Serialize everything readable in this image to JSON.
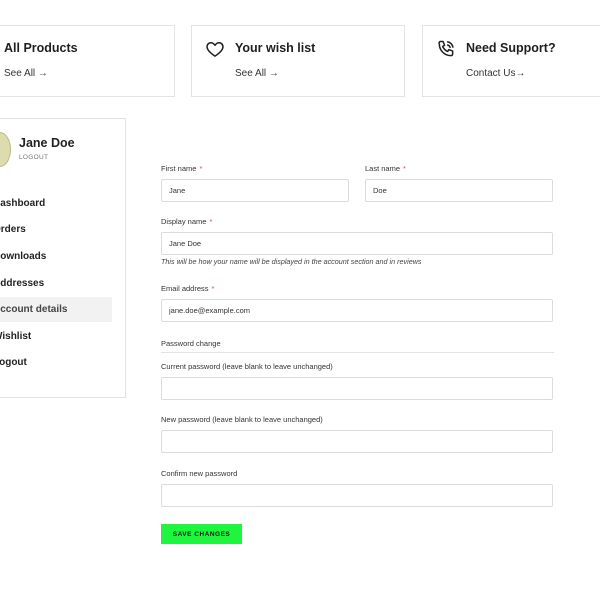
{
  "cards": [
    {
      "title": "All Products",
      "link": "See All →",
      "icon": "none"
    },
    {
      "title": "Your wish list",
      "link": "See All →",
      "icon": "heart-icon"
    },
    {
      "title": "Need Support?",
      "link": "Contact Us→",
      "icon": "phone-icon"
    }
  ],
  "user": {
    "name": "Jane Doe",
    "logout_label": "LOGOUT"
  },
  "nav": {
    "items": [
      {
        "label": "Dashboard"
      },
      {
        "label": "Orders"
      },
      {
        "label": "Downloads"
      },
      {
        "label": "Addresses"
      },
      {
        "label": "Account details",
        "active": true
      },
      {
        "label": "Wishlist"
      },
      {
        "label": "Logout"
      }
    ]
  },
  "form": {
    "first_name": {
      "label": "First name",
      "value": "Jane"
    },
    "last_name": {
      "label": "Last name",
      "value": "Doe"
    },
    "display_name": {
      "label": "Display name",
      "value": "Jane Doe",
      "hint": "This will be how your name will be displayed in the account section and in reviews"
    },
    "email": {
      "label": "Email address",
      "value": "jane.doe@example.com"
    },
    "required_mark": "*",
    "password_section": "Password change",
    "current_password": {
      "label": "Current password (leave blank to leave unchanged)",
      "value": ""
    },
    "new_password": {
      "label": "New password (leave blank to leave unchanged)",
      "value": ""
    },
    "confirm_password": {
      "label": "Confirm new password",
      "value": ""
    },
    "save_label": "SAVE CHANGES"
  },
  "colors": {
    "accent": "#1ff53e",
    "required": "#e04545",
    "border": "#dcdcdc"
  }
}
